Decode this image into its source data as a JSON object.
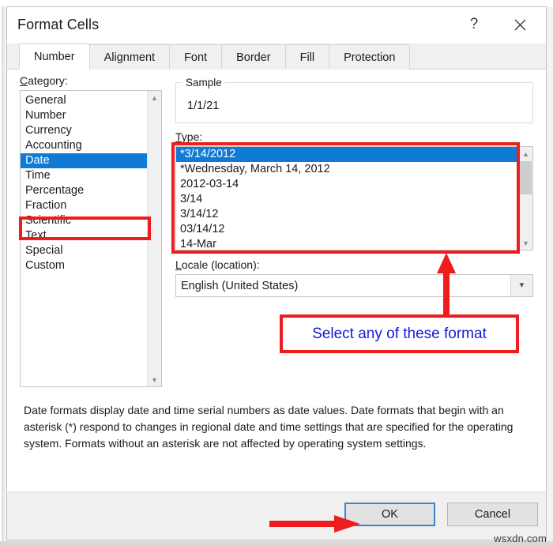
{
  "window": {
    "title": "Format Cells",
    "help_icon": "question-mark-icon",
    "close_icon": "close-icon"
  },
  "tabs": [
    {
      "label": "Number",
      "active": true
    },
    {
      "label": "Alignment",
      "active": false
    },
    {
      "label": "Font",
      "active": false
    },
    {
      "label": "Border",
      "active": false
    },
    {
      "label": "Fill",
      "active": false
    },
    {
      "label": "Protection",
      "active": false
    }
  ],
  "category": {
    "label": "Category:",
    "accesskey": "C",
    "selected": "Date",
    "items": [
      "General",
      "Number",
      "Currency",
      "Accounting",
      "Date",
      "Time",
      "Percentage",
      "Fraction",
      "Scientific",
      "Text",
      "Special",
      "Custom"
    ]
  },
  "sample": {
    "legend": "Sample",
    "value": "1/1/21"
  },
  "type": {
    "label": "Type:",
    "accesskey": "T",
    "selected": "*3/14/2012",
    "items": [
      "*3/14/2012",
      "*Wednesday, March 14, 2012",
      "2012-03-14",
      "3/14",
      "3/14/12",
      "03/14/12",
      "14-Mar"
    ]
  },
  "locale": {
    "label": "Locale (location):",
    "accesskey": "L",
    "value": "English (United States)",
    "dropdown_icon": "chevron-down-icon"
  },
  "annotation": {
    "callout_text": "Select any of these format",
    "callout_border_color": "#ee1c1c",
    "callout_text_color": "#1717d6",
    "arrow_color": "#ee1c1c",
    "type_highlight_color": "#ee1c1c",
    "category_highlight_color": "#ee1c1c"
  },
  "description": "Date formats display date and time serial numbers as date values.  Date formats that begin with an asterisk (*) respond to changes in regional date and time settings that are specified for the operating system. Formats without an asterisk are not affected by operating system settings.",
  "footer": {
    "ok_label": "OK",
    "cancel_label": "Cancel"
  },
  "watermark": "wsxdn.com",
  "colors": {
    "selection_blue": "#0f7bd6",
    "annotation_red": "#ee1c1c",
    "annotation_blue": "#1717d6",
    "focus_border": "#3b86c9"
  }
}
